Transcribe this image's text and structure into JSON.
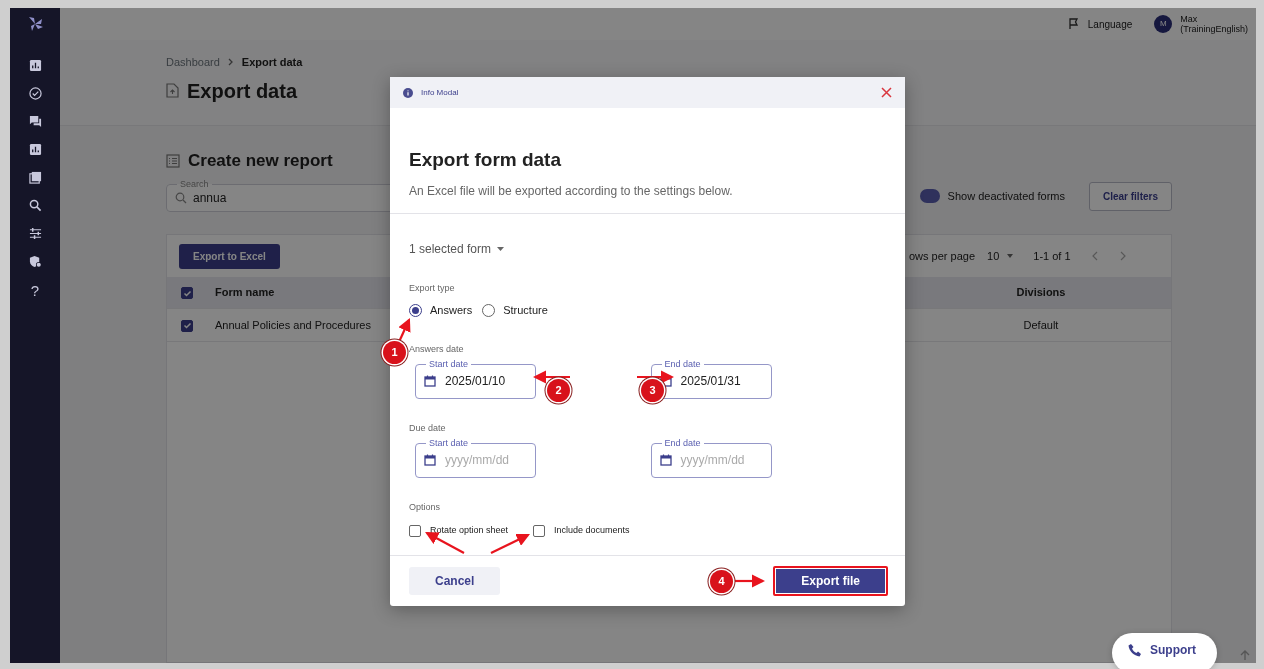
{
  "sidebar": {
    "items": [
      {
        "kind": "chart"
      },
      {
        "kind": "check"
      },
      {
        "kind": "chat"
      },
      {
        "kind": "chart"
      },
      {
        "kind": "cards"
      },
      {
        "kind": "search"
      },
      {
        "kind": "sliders"
      },
      {
        "kind": "shield"
      },
      {
        "kind": "text",
        "label": "?"
      }
    ]
  },
  "header": {
    "language": "Language",
    "user": {
      "initial": "M",
      "name": "Max",
      "org": "(TrainingEnglish)"
    }
  },
  "breadcrumb": [
    "Dashboard",
    "Export data"
  ],
  "page_title": "Export data",
  "section_title": "Create new report",
  "search": {
    "label": "Search",
    "value": "annua"
  },
  "deactivated_toggle": {
    "label": "Show deactivated forms",
    "on": true
  },
  "clear_filters": "Clear filters",
  "table": {
    "export_button": "Export to Excel",
    "rows_per_page_label": "ows per page",
    "rows_per_page": "10",
    "range": "1-1 of 1",
    "header_checked": true,
    "columns": [
      "Form name",
      "Divisions"
    ],
    "rows": [
      {
        "checked": true,
        "cells": [
          "Annual Policies and Procedures",
          "Default"
        ]
      }
    ]
  },
  "modal": {
    "header": "Info Modal",
    "title": "Export form data",
    "subtitle": "An Excel file will be exported according to the settings below.",
    "form_selector": "1 selected form",
    "export_type": {
      "label": "Export type",
      "options": [
        {
          "label": "Answers",
          "selected": true
        },
        {
          "label": "Structure",
          "selected": false
        }
      ]
    },
    "date_groups": [
      {
        "label": "Answers date",
        "fields": [
          {
            "label": "Start date",
            "value": "2025/01/10"
          },
          {
            "label": "End date",
            "value": "2025/01/31"
          }
        ]
      },
      {
        "label": "Due date",
        "fields": [
          {
            "label": "Start date",
            "placeholder": "yyyy/mm/dd"
          },
          {
            "label": "End date",
            "placeholder": "yyyy/mm/dd"
          }
        ]
      }
    ],
    "options": {
      "label": "Options",
      "items": [
        {
          "label": "Rotate option sheet",
          "checked": false
        },
        {
          "label": "Include documents",
          "checked": false
        }
      ]
    },
    "cancel": "Cancel",
    "submit": {
      "label": "Export file",
      "highlighted": true
    }
  },
  "annotations": [
    {
      "label": "1"
    },
    {
      "label": "2"
    },
    {
      "label": "3"
    },
    {
      "label": "4"
    }
  ],
  "support": "Support"
}
